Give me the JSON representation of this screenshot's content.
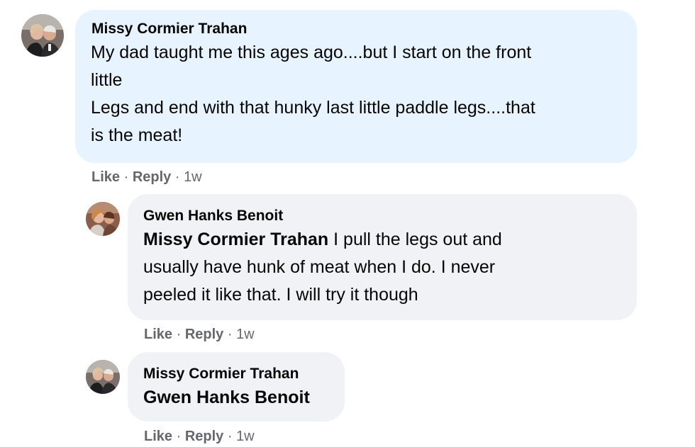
{
  "comments": [
    {
      "author": "Missy Cormier Trahan",
      "lines": [
        "My dad taught me this ages ago....but I start on the front",
        "little",
        "Legs and end with that hunky last little paddle legs....that",
        "is the meat!"
      ],
      "like_label": "Like",
      "reply_label": "Reply",
      "time": "1w",
      "avatar_icon": "profile-photo"
    },
    {
      "author": "Gwen Hanks Benoit",
      "mention": "Missy Cormier Trahan",
      "lines": [
        " I pull the legs out and",
        "usually have hunk of meat when I do. I never",
        "peeled it like that. I will try it though"
      ],
      "like_label": "Like",
      "reply_label": "Reply",
      "time": "1w",
      "avatar_icon": "profile-photo"
    },
    {
      "author": "Missy Cormier Trahan",
      "mention": "Gwen Hanks Benoit",
      "like_label": "Like",
      "reply_label": "Reply",
      "time": "1w",
      "avatar_icon": "profile-photo"
    }
  ],
  "separator": "·",
  "colors": {
    "highlight_bubble": "#e7f3ff",
    "reply_bubble": "#f0f2f5",
    "secondary_text": "#65676b"
  }
}
